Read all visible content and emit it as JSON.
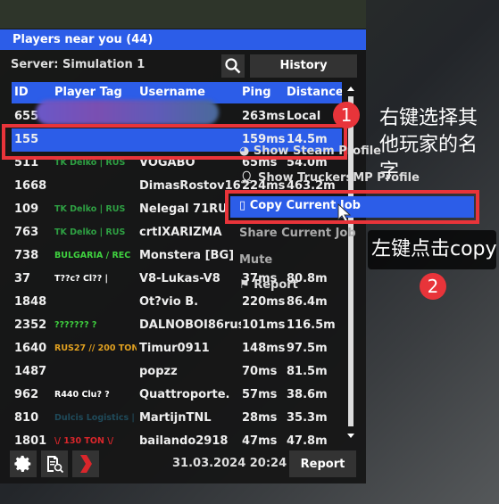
{
  "title": "Players near you (44)",
  "server": "Server: Simulation 1",
  "history_label": "History",
  "columns": [
    "ID",
    "Player Tag",
    "Username",
    "Ping",
    "Distance"
  ],
  "rows": [
    {
      "id": "655",
      "tag": "CN-ACC-Team",
      "tag_color": "#d9262b",
      "user": "XiaoBian",
      "ping": "263ms",
      "dist": "Local"
    },
    {
      "id": "155",
      "tag": "",
      "tag_color": "#2ea043",
      "user": "",
      "ping": "159ms",
      "dist": "14.5m",
      "selected": true
    },
    {
      "id": "511",
      "tag": "TK Delko | RUS",
      "tag_color": "#2ea043",
      "user": "VOGABO",
      "ping": "65ms",
      "dist": "54.0m"
    },
    {
      "id": "1668",
      "tag": "",
      "tag_color": "#ffffff",
      "user": "DimasRostov161",
      "ping": "224ms",
      "dist": "463.2m"
    },
    {
      "id": "109",
      "tag": "TK Delko | RUS",
      "tag_color": "#2ea043",
      "user": "Nelegal 71RU",
      "ping": "",
      "dist": ""
    },
    {
      "id": "763",
      "tag": "TK Delko | RUS",
      "tag_color": "#2ea043",
      "user": "crtIXARIZMA",
      "ping": "",
      "dist": ""
    },
    {
      "id": "738",
      "tag": "BULGARIA / REC",
      "tag_color": "#3fd13f",
      "user": "Monstera [BG]",
      "ping": "",
      "dist": ""
    },
    {
      "id": "37",
      "tag": "T??c? Cl?? |",
      "tag_color": "#ffffff",
      "user": "V8-Lukas-V8",
      "ping": "37ms",
      "dist": "80.8m"
    },
    {
      "id": "1848",
      "tag": "",
      "tag_color": "#ffffff",
      "user": "Ot?vio B.",
      "ping": "220ms",
      "dist": "86.4m"
    },
    {
      "id": "2352",
      "tag": "??????? ?",
      "tag_color": "#3fd13f",
      "user": "DALNOBOI86rus",
      "ping": "101ms",
      "dist": "116.5m"
    },
    {
      "id": "1640",
      "tag": "RUS27 // 200 TON",
      "tag_color": "#e0a020",
      "user": "Timur0911",
      "ping": "148ms",
      "dist": "97.5m"
    },
    {
      "id": "1487",
      "tag": "",
      "tag_color": "#ffffff",
      "user": "popzz",
      "ping": "70ms",
      "dist": "81.5m"
    },
    {
      "id": "962",
      "tag": "R440 Clu? ?",
      "tag_color": "#ffffff",
      "user": "Quattroporte.",
      "ping": "57ms",
      "dist": "38.6m"
    },
    {
      "id": "810",
      "tag": "Dulcis Logistics |",
      "tag_color": "#1f4a5a",
      "user": "MartijnTNL",
      "ping": "28ms",
      "dist": "35.3m"
    },
    {
      "id": "1801",
      "tag": "\\/ 130 TON \\/",
      "tag_color": "#d9262b",
      "user": "bailando2918",
      "ping": "47ms",
      "dist": "47.8m"
    }
  ],
  "footer": {
    "datetime": "31.03.2024 20:24",
    "report_label": "Report"
  },
  "context_menu": {
    "items": [
      "Show Steam Profile",
      "Show TruckersMP Profile",
      "Copy Current Job",
      "Share Current Job",
      "Mute",
      "Report"
    ],
    "highlighted": "Copy Current Job"
  },
  "annotations": {
    "badge1": "1",
    "badge2": "2",
    "note1": "右键选择其他玩家的名字",
    "note2": "左键点击copy"
  },
  "colors": {
    "accent": "#2c5de8",
    "annotation": "#e8343a"
  }
}
